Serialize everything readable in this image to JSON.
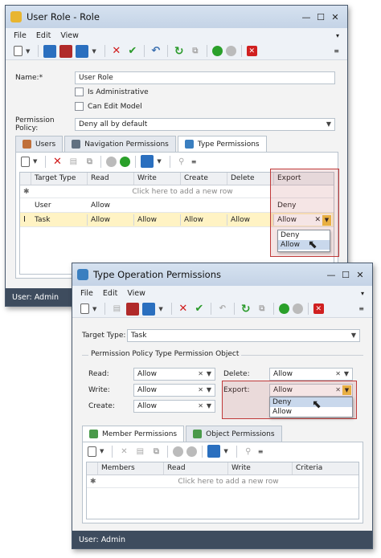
{
  "win1": {
    "title": "User Role - Role",
    "menu": [
      "File",
      "Edit",
      "View"
    ],
    "name_label": "Name:*",
    "name_value": "User Role",
    "is_admin_label": "Is Administrative",
    "can_edit_label": "Can Edit Model",
    "policy_label": "Permission Policy:",
    "policy_value": "Deny all by default",
    "tabs": [
      "Users",
      "Navigation Permissions",
      "Type Permissions"
    ],
    "grid_headers": [
      "Target Type",
      "Read",
      "Write",
      "Create",
      "Delete",
      "Export"
    ],
    "add_row_text": "Click here to add a new row",
    "rows": [
      {
        "target": "User",
        "read": "Allow",
        "write": "",
        "create": "",
        "delete": "",
        "export": "Deny"
      },
      {
        "target": "Task",
        "read": "Allow",
        "write": "Allow",
        "create": "Allow",
        "delete": "Allow",
        "export": "Allow"
      }
    ],
    "export_options": [
      "Deny",
      "Allow"
    ],
    "status": "User: Admin"
  },
  "win2": {
    "title": "Type Operation Permissions",
    "menu": [
      "File",
      "Edit",
      "View"
    ],
    "target_label": "Target Type:",
    "target_value": "Task",
    "group_title": "Permission Policy Type Permission Object",
    "read_label": "Read:",
    "read_value": "Allow",
    "write_label": "Write:",
    "write_value": "Allow",
    "create_label": "Create:",
    "create_value": "Allow",
    "delete_label": "Delete:",
    "delete_value": "Allow",
    "export_label": "Export:",
    "export_value": "Allow",
    "export_options": [
      "Deny",
      "Allow"
    ],
    "tabs": [
      "Member Permissions",
      "Object Permissions"
    ],
    "grid_headers": [
      "Members",
      "Read",
      "Write",
      "Criteria"
    ],
    "add_row_text": "Click here to add a new row",
    "status": "User: Admin"
  },
  "colors": {
    "accent": "#3e4c5e",
    "highlight": "#c03a3a",
    "selected_row": "#fff3c4"
  }
}
